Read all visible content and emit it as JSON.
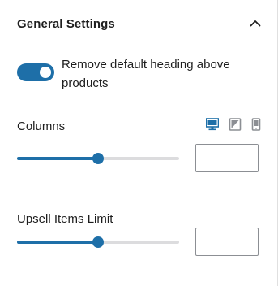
{
  "section": {
    "title": "General Settings",
    "expanded": true
  },
  "toggle": {
    "label": "Remove default heading above products",
    "checked": true
  },
  "columns": {
    "label": "Columns",
    "value": "",
    "slider_fraction": 0.5,
    "devices": [
      "desktop-icon",
      "tablet-icon",
      "mobile-icon"
    ],
    "active_device": "desktop"
  },
  "upsell": {
    "label": "Upsell Items Limit",
    "value": "",
    "slider_fraction": 0.5
  },
  "colors": {
    "accent": "#1e6fa8",
    "track": "#dcdcde",
    "inactive_icon": "#8c8f94"
  }
}
